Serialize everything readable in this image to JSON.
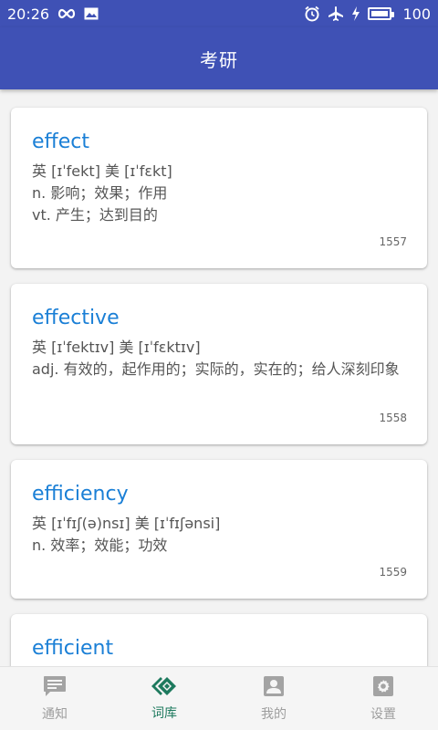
{
  "status_bar": {
    "time": "20:26",
    "battery_percent": "100",
    "icons": [
      "infinity-icon",
      "image-icon",
      "alarm-icon",
      "airplane-icon",
      "charging-icon",
      "battery-icon"
    ]
  },
  "app_bar": {
    "title": "考研"
  },
  "words": [
    {
      "word": "effect",
      "phonetic": "英 [ɪˈfekt]  美 [ɪˈfɛkt]",
      "definitions": [
        "n. 影响；效果；作用",
        "vt. 产生；达到目的"
      ],
      "number": "1557"
    },
    {
      "word": "effective",
      "phonetic": "英 [ɪˈfektɪv]  美 [ɪˈfɛktɪv]",
      "definitions": [
        "adj. 有效的，起作用的；实际的，实在的；给人深刻印象"
      ],
      "number": "1558"
    },
    {
      "word": "efficiency",
      "phonetic": "英 [ɪˈfɪʃ(ə)nsɪ]  美 [ɪˈfɪʃənsi]",
      "definitions": [
        "n. 效率；效能；功效"
      ],
      "number": "1559"
    },
    {
      "word": "efficient"
    }
  ],
  "bottom_nav": {
    "items": [
      {
        "label": "通知",
        "icon": "message-icon",
        "active": false
      },
      {
        "label": "词库",
        "icon": "vocabulary-icon",
        "active": true
      },
      {
        "label": "我的",
        "icon": "profile-icon",
        "active": false
      },
      {
        "label": "设置",
        "icon": "settings-icon",
        "active": false
      }
    ]
  },
  "colors": {
    "primary": "#3f51b5",
    "word_link": "#1a7fd6",
    "nav_active": "#1e7a5e",
    "nav_inactive": "#9e9e9e"
  }
}
